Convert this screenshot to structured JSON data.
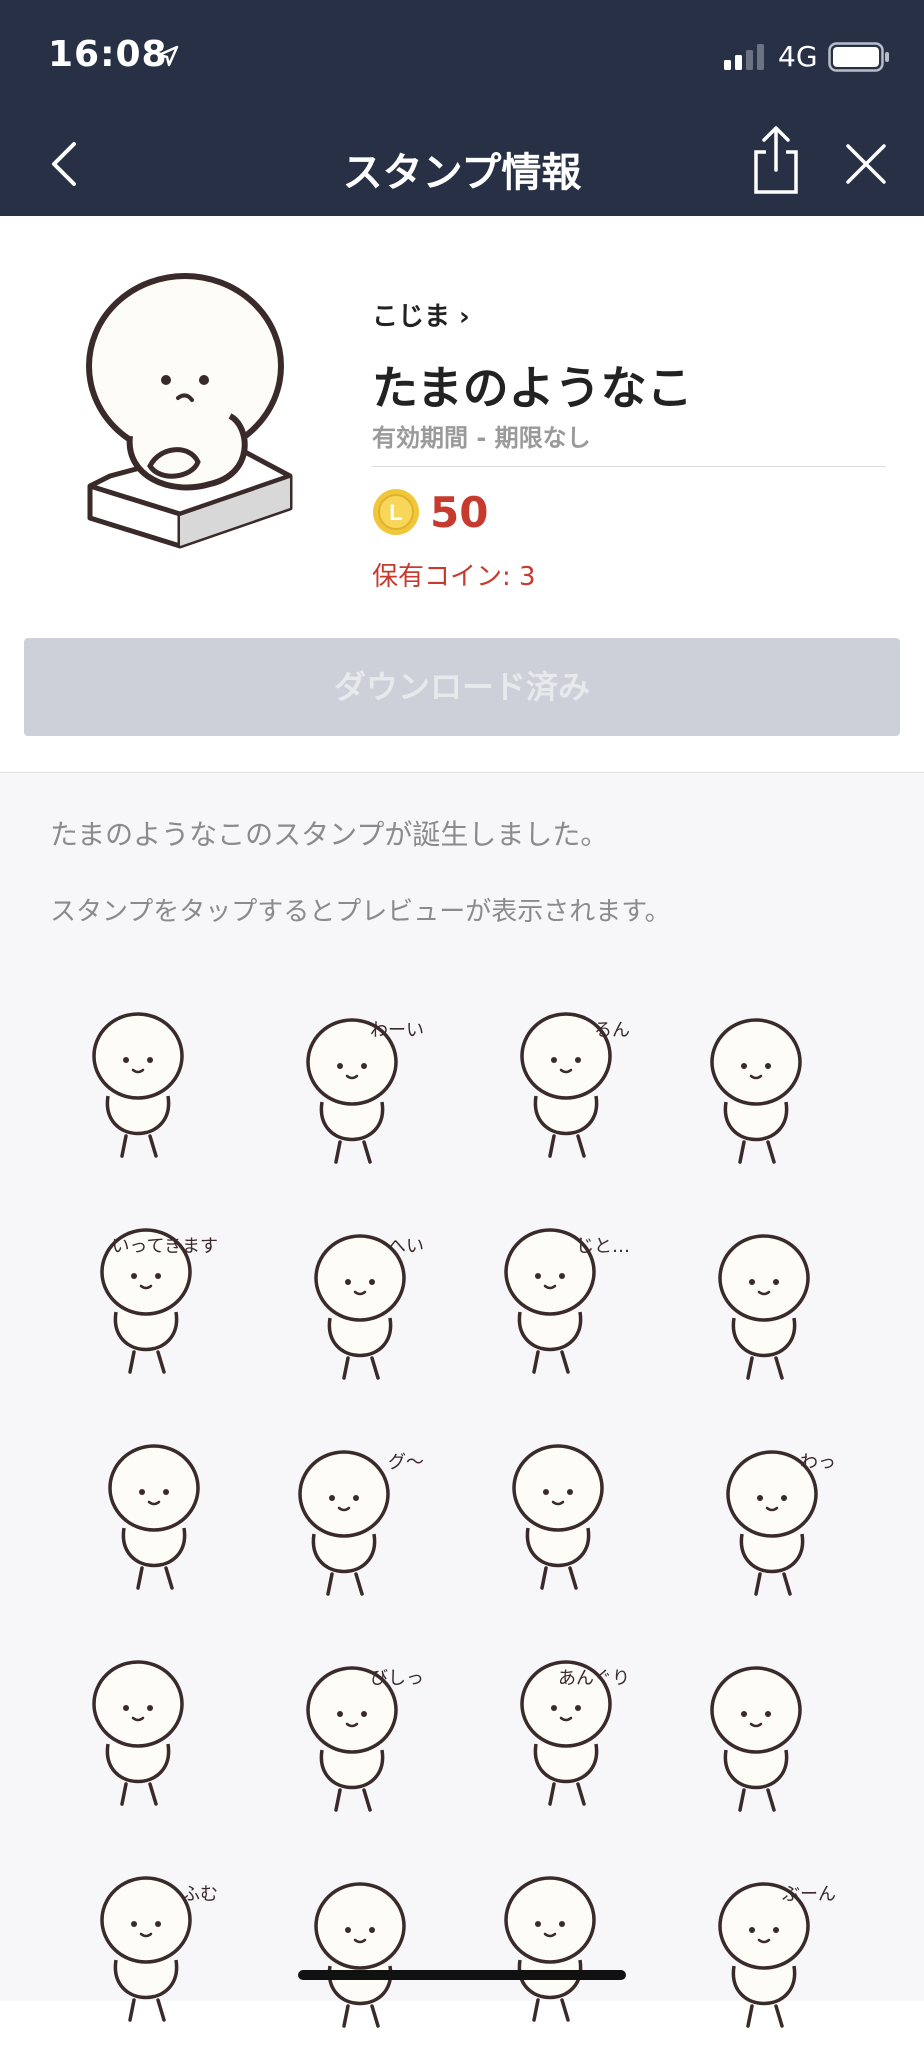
{
  "status_bar": {
    "time": "16:08",
    "network": "4G"
  },
  "nav": {
    "title": "スタンプ情報"
  },
  "pack": {
    "author": "こじま ›",
    "title": "たまのようなこ",
    "validity": "有効期間 - 期限なし",
    "coin_letter": "L",
    "price": "50",
    "owned_coins": "保有コイン: 3",
    "download_label": "ダウンロード済み"
  },
  "description": {
    "line1": "たまのようなこのスタンプが誕生しました。",
    "line2": "スタンプをタップするとプレビューが表示されます。"
  },
  "stickers": [
    {
      "icon": "sticker-sitting-on-box",
      "text": ""
    },
    {
      "icon": "sticker-running-donut",
      "text": "わーい"
    },
    {
      "icon": "sticker-kick-pink",
      "text": "るん"
    },
    {
      "icon": "sticker-cheering",
      "text": ""
    },
    {
      "icon": "sticker-going-out",
      "text": "いってきます"
    },
    {
      "icon": "sticker-hey",
      "text": "へい"
    },
    {
      "icon": "sticker-staring",
      "text": "じと…"
    },
    {
      "icon": "sticker-bindle",
      "text": ""
    },
    {
      "icon": "sticker-lying-down",
      "text": ""
    },
    {
      "icon": "sticker-tummy-growl",
      "text": "グ〜"
    },
    {
      "icon": "sticker-looking-back",
      "text": ""
    },
    {
      "icon": "sticker-surprised",
      "text": "わっ"
    },
    {
      "icon": "sticker-headstand",
      "text": ""
    },
    {
      "icon": "sticker-startled",
      "text": "びしっ"
    },
    {
      "icon": "sticker-open-mouth",
      "text": "あんぐり"
    },
    {
      "icon": "sticker-hug-toast",
      "text": ""
    },
    {
      "icon": "sticker-hmm",
      "text": "ふむ"
    },
    {
      "icon": "sticker-standing",
      "text": ""
    },
    {
      "icon": "sticker-sweeping",
      "text": ""
    },
    {
      "icon": "sticker-pink-car",
      "text": "ぶーん"
    }
  ],
  "colors": {
    "nav_bg": "#283046",
    "price_red": "#c63b2e",
    "coin_gold": "#f2c63a",
    "button_gray": "#cdd0d8"
  }
}
